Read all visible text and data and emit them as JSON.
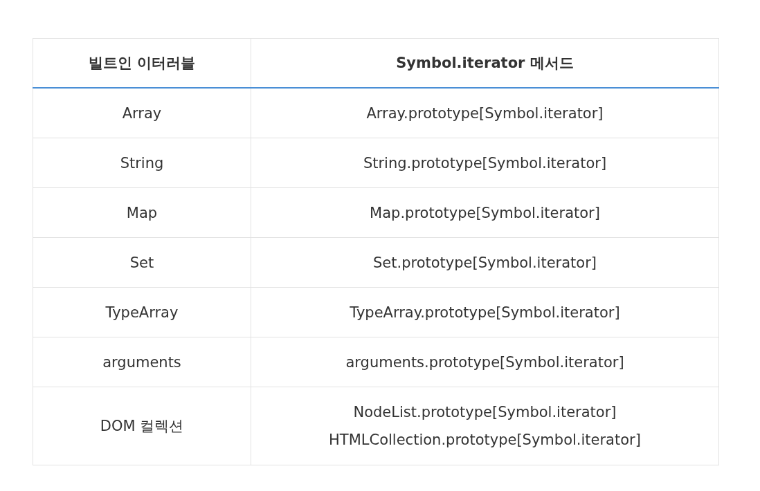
{
  "table": {
    "columns": [
      "빌트인 이터러블",
      "Symbol.iterator 메서드"
    ],
    "rows": [
      {
        "iterable": "Array",
        "methods": [
          "Array.prototype[Symbol.iterator]"
        ]
      },
      {
        "iterable": "String",
        "methods": [
          "String.prototype[Symbol.iterator]"
        ]
      },
      {
        "iterable": "Map",
        "methods": [
          "Map.prototype[Symbol.iterator]"
        ]
      },
      {
        "iterable": "Set",
        "methods": [
          "Set.prototype[Symbol.iterator]"
        ]
      },
      {
        "iterable": "TypeArray",
        "methods": [
          "TypeArray.prototype[Symbol.iterator]"
        ]
      },
      {
        "iterable": "arguments",
        "methods": [
          "arguments.prototype[Symbol.iterator]"
        ]
      },
      {
        "iterable": "DOM 컬렉션",
        "methods": [
          "NodeList.prototype[Symbol.iterator]",
          "HTMLCollection.prototype[Symbol.iterator]"
        ]
      }
    ]
  }
}
